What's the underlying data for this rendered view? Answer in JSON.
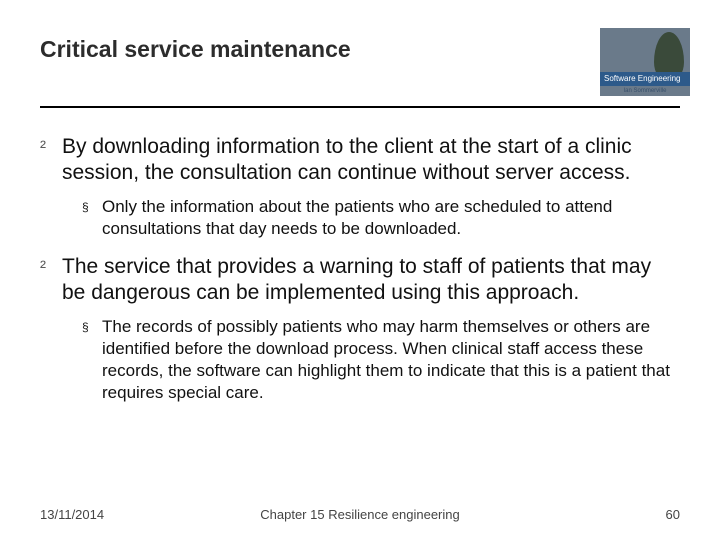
{
  "header": {
    "title": "Critical service maintenance",
    "logo": {
      "band_text": "Software Engineering",
      "author_text": "Ian Sommerville"
    }
  },
  "bullets": [
    {
      "text": "By downloading information to the client at the start of a clinic session, the consultation can continue without server access.",
      "sub": [
        "Only the information about the patients who are scheduled to attend consultations that day needs to be downloaded."
      ]
    },
    {
      "text": "The service that provides a warning to staff of patients that may be dangerous can be implemented using this approach.",
      "sub": [
        "The records of possibly patients who may harm themselves or others are identified before the download process. When clinical staff access these records, the software can highlight them to indicate that this is a patient that requires special care."
      ]
    }
  ],
  "footer": {
    "date": "13/11/2014",
    "chapter": "Chapter 15 Resilience engineering",
    "page": "60"
  }
}
